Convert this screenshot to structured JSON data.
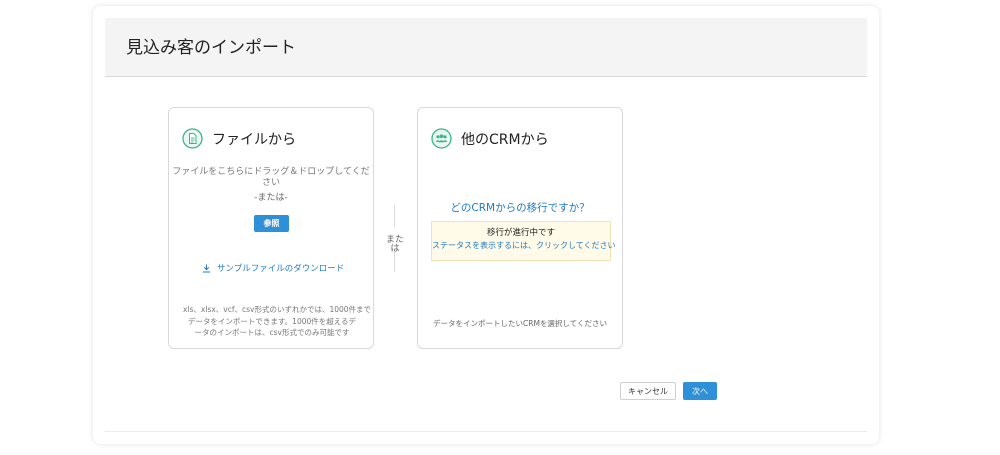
{
  "header": {
    "title": "見込み客のインポート"
  },
  "file_card": {
    "title": "ファイルから",
    "icon": "document-icon",
    "drop_text": "ファイルをこちらにドラッグ＆ドロップしてください",
    "or_text": "-または-",
    "browse_label": "参照",
    "download_label": "サンプルファイルのダウンロード",
    "download_icon": "download-icon",
    "note_lines": [
      "xls、xlsx、vcf、csv形式のいずれかでは、1000件まで",
      "データをインポートできます。1000件を超えるデ",
      "ータのインポートは、csv形式でのみ可能です"
    ]
  },
  "divider": {
    "text": "または"
  },
  "crm_card": {
    "title": "他のCRMから",
    "icon": "group-icon",
    "question": "どのCRMからの移行ですか？",
    "notice_title": "移行が進行中です",
    "notice_link": "ステータスを表示するには、クリックしてください",
    "select_hint": "データをインポートしたいCRMを選択してください"
  },
  "actions": {
    "cancel_label": "キャンセル",
    "next_label": "次へ"
  },
  "colors": {
    "accent": "#2e90d8",
    "link": "#1f7ac5",
    "icon_green": "#3cb48c",
    "notice_bg": "#fffbe8"
  }
}
